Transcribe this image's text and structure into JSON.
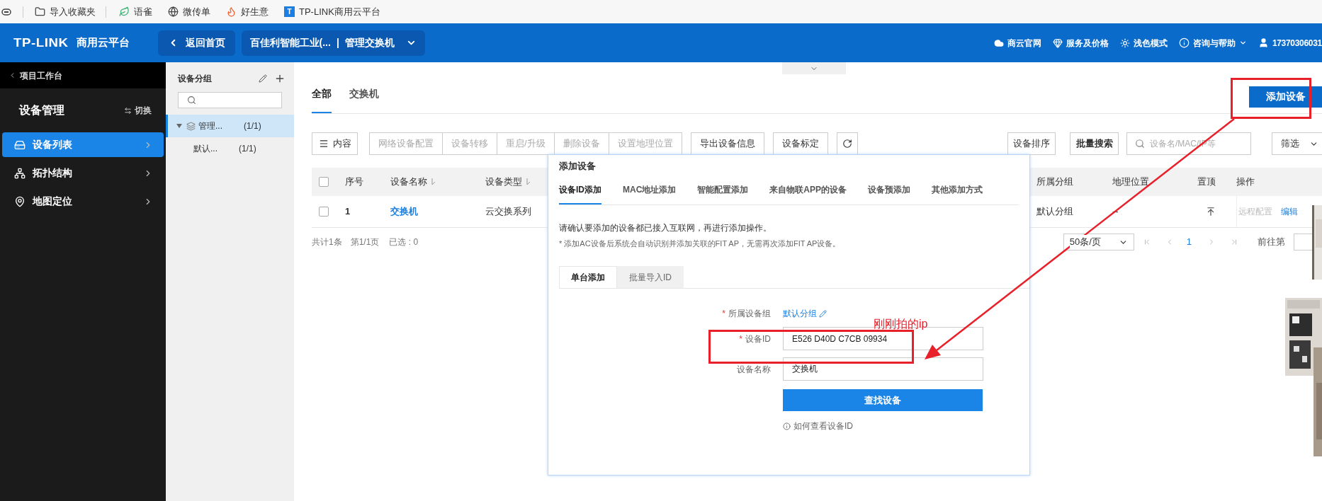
{
  "bookmarks": [
    {
      "label": "导入收藏夹",
      "kind": "folder"
    },
    {
      "label": "语雀",
      "kind": "leaf"
    },
    {
      "label": "微传单",
      "kind": "globe"
    },
    {
      "label": "好生意",
      "kind": "flame"
    },
    {
      "label": "TP-LINK商用云平台",
      "kind": "tile",
      "tile_letter": "T"
    }
  ],
  "header": {
    "logo": "TP-LINK",
    "product": "商用云平台",
    "back_button": "返回首页",
    "project": "百佳利智能工业(...",
    "project_separator": "|",
    "project_page": "管理交换机",
    "links": [
      {
        "label": "商云官网",
        "kind": "cloud",
        "dropdown": false
      },
      {
        "label": "服务及价格",
        "kind": "diamond",
        "dropdown": false
      },
      {
        "label": "浅色模式",
        "kind": "sun",
        "dropdown": false
      },
      {
        "label": "咨询与帮助",
        "kind": "info",
        "dropdown": true
      }
    ],
    "user": "17370306031"
  },
  "sidebar": {
    "back_label": "项目工作台",
    "title": "设备管理",
    "switch_label": "切换",
    "items": [
      {
        "label": "设备列表",
        "kind": "device",
        "selected": true
      },
      {
        "label": "拓扑结构",
        "kind": "topology",
        "selected": false
      },
      {
        "label": "地图定位",
        "kind": "map",
        "selected": false
      }
    ]
  },
  "group_panel": {
    "title": "设备分组",
    "tree": [
      {
        "label": "管理...",
        "count": "(1/1)",
        "expanded": true,
        "selected": true,
        "children": [
          {
            "label": "默认...",
            "count": "(1/1)",
            "selected": false
          }
        ]
      }
    ]
  },
  "tabs": [
    {
      "label": "全部",
      "selected": true
    },
    {
      "label": "交换机",
      "selected": false
    }
  ],
  "add_button": "添加设备",
  "toolbar": {
    "content_button": "内容",
    "batch_actions": [
      {
        "label": "网络设备配置",
        "disabled": true
      },
      {
        "label": "设备转移",
        "disabled": true
      },
      {
        "label": "重启/升级",
        "disabled": true
      },
      {
        "label": "删除设备",
        "disabled": true
      },
      {
        "label": "设置地理位置",
        "disabled": true
      }
    ],
    "actions": [
      "导出设备信息",
      "设备标定"
    ],
    "sort_button": "设备排序",
    "batch_search_button": "批量搜索",
    "search_placeholder": "设备名/MAC/IP等",
    "filter": "筛选"
  },
  "table": {
    "select_all_checked": false,
    "columns": [
      {
        "label": "序号",
        "sortable": false
      },
      {
        "label": "设备名称",
        "sortable": true
      },
      {
        "label": "设备类型",
        "sortable": true
      },
      {
        "label": "所属分组",
        "sortable": false
      },
      {
        "label": "地理位置",
        "sortable": false
      },
      {
        "label": "置顶",
        "sortable": false
      },
      {
        "label": "操作",
        "sortable": false
      }
    ],
    "rows": [
      {
        "checked": false,
        "index": "1",
        "name": "交换机",
        "type": "云交换系列",
        "group": "默认分组",
        "location": "--",
        "actions": [
          {
            "label": "远程配置",
            "disabled": true
          },
          {
            "label": "编辑",
            "disabled": false
          }
        ]
      }
    ]
  },
  "footer": {
    "total": "共计1条",
    "page": "第1/1页",
    "selected_count": "已选 : 0"
  },
  "pagination": {
    "page_size": "50条/页",
    "pages": [
      {
        "label": "1",
        "selected": true
      }
    ],
    "goto_label": "前往第"
  },
  "dialog": {
    "title": "添加设备",
    "tabs": [
      {
        "label": "设备ID添加",
        "selected": true
      },
      {
        "label": "MAC地址添加",
        "selected": false
      },
      {
        "label": "智能配置添加",
        "selected": false
      },
      {
        "label": "来自物联APP的设备",
        "selected": false
      },
      {
        "label": "设备预添加",
        "selected": false
      },
      {
        "label": "其他添加方式",
        "selected": false
      }
    ],
    "notice": "请确认要添加的设备都已接入互联网，再进行添加操作。",
    "note": "* 添加AC设备后系统会自动识别并添加关联的FIT AP，无需再次添加FIT AP设备。",
    "subtabs": [
      {
        "label": "单台添加",
        "selected": true
      },
      {
        "label": "批量导入ID",
        "selected": false
      }
    ],
    "fields": [
      {
        "label": "所属设备组",
        "required_mark": "*",
        "kind": "link",
        "value": "默认分组"
      },
      {
        "label": "设备ID",
        "required_mark": "*",
        "kind": "input",
        "value": "E526 D40D C7CB 09934"
      },
      {
        "label": "设备名称",
        "kind": "input",
        "value": "交换机"
      }
    ],
    "submit": "查找设备",
    "help": "如何查看设备ID"
  },
  "annotation": {
    "note": "刚刚拍的ip"
  }
}
